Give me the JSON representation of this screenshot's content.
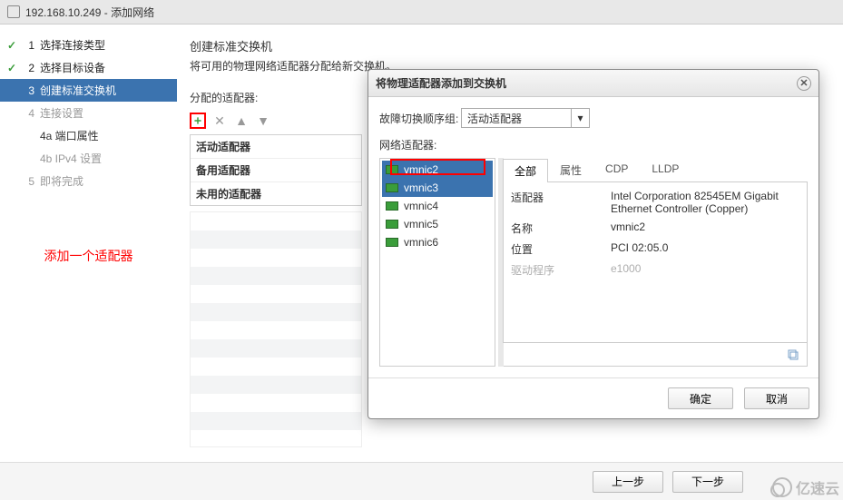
{
  "title": "192.168.10.249 - 添加网络",
  "steps": {
    "s1": {
      "num": "1",
      "label": "选择连接类型"
    },
    "s2": {
      "num": "2",
      "label": "选择目标设备"
    },
    "s3": {
      "num": "3",
      "label": "创建标准交换机"
    },
    "s4": {
      "num": "4",
      "label": "连接设置"
    },
    "s4a": {
      "label": "4a 端口属性"
    },
    "s4b": {
      "label": "4b IPv4 设置"
    },
    "s5": {
      "num": "5",
      "label": "即将完成"
    }
  },
  "annotation": "添加一个适配器",
  "main": {
    "heading": "创建标准交换机",
    "sub": "将可用的物理网络适配器分配给新交换机。",
    "assigned_label": "分配的适配器:",
    "groups": {
      "active": "活动适配器",
      "standby": "备用适配器",
      "unused": "未用的适配器"
    }
  },
  "modal": {
    "title": "将物理适配器添加到交换机",
    "failover_label": "故障切换顺序组:",
    "failover_value": "活动适配器",
    "nic_label": "网络适配器:",
    "nics": [
      "vmnic2",
      "vmnic3",
      "vmnic4",
      "vmnic5",
      "vmnic6"
    ],
    "tabs": {
      "all": "全部",
      "props": "属性",
      "cdp": "CDP",
      "lldp": "LLDP"
    },
    "details": {
      "adapter_label": "适配器",
      "adapter_value": "Intel Corporation 82545EM Gigabit Ethernet Controller (Copper)",
      "name_label": "名称",
      "name_value": "vmnic2",
      "location_label": "位置",
      "location_value": "PCI 02:05.0",
      "driver_label": "驱动程序",
      "driver_value": "e1000"
    },
    "ok": "确定",
    "cancel": "取消"
  },
  "footer": {
    "back": "上一步",
    "next": "下一步"
  },
  "watermark": "亿速云"
}
